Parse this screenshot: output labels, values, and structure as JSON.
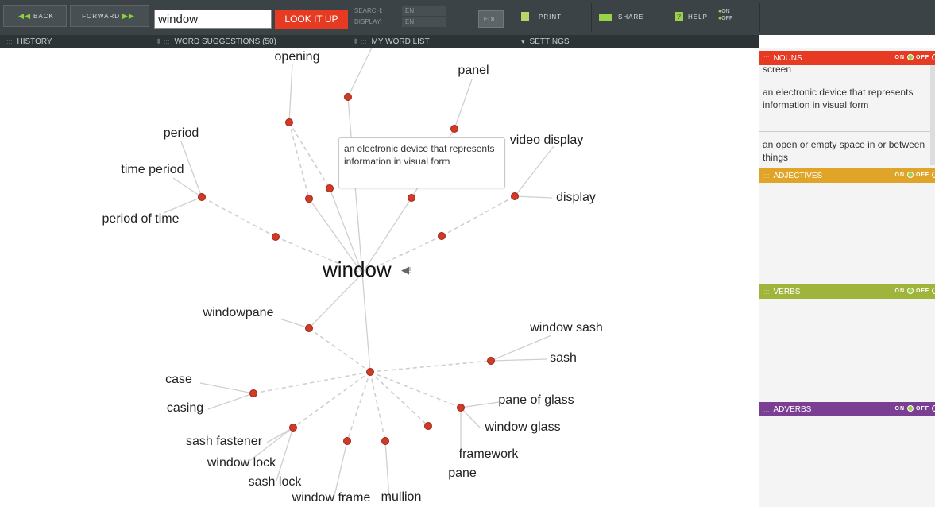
{
  "toolbar": {
    "back_label": "BACK",
    "forward_label": "FORWARD",
    "search_value": "window",
    "lookup_label": "LOOK IT UP",
    "search_lang_label": "SEARCH:",
    "search_lang_value": "EN",
    "display_lang_label": "DISPLAY:",
    "display_lang_value": "EN",
    "edit_label": "EDIT",
    "print_label": "PRINT",
    "share_label": "SHARE",
    "help_label": "HELP",
    "help_on": "ON",
    "help_off": "OFF"
  },
  "subbar": {
    "history": "HISTORY",
    "suggestions": "WORD SUGGESTIONS (50)",
    "wordlist": "MY WORD LIST",
    "settings": "SETTINGS"
  },
  "graph": {
    "center_word": "window",
    "tooltip": "an electronic device that represents information in visual form",
    "labels": {
      "opening": "opening",
      "panel": "panel",
      "period": "period",
      "video_display": "video display",
      "time_period": "time period",
      "display": "display",
      "period_of_time": "period of time",
      "windowpane": "windowpane",
      "window_sash": "window sash",
      "sash": "sash",
      "case": "case",
      "pane_of_glass": "pane of glass",
      "casing": "casing",
      "window_glass": "window glass",
      "sash_fastener": "sash fastener",
      "framework": "framework",
      "window_lock": "window lock",
      "pane": "pane",
      "sash_lock": "sash lock",
      "window_frame": "window frame",
      "mullion": "mullion"
    }
  },
  "panel": {
    "nouns": {
      "title": "NOUNS",
      "on": "ON",
      "off": "OFF",
      "color": "#e63a22",
      "cut_text": "screen",
      "def1": "an electronic device that represents information in visual form",
      "def2": "an open or empty space in or between things"
    },
    "adjectives": {
      "title": "ADJECTIVES",
      "on": "ON",
      "off": "OFF",
      "color": "#e0a528"
    },
    "verbs": {
      "title": "VERBS",
      "on": "ON",
      "off": "OFF",
      "color": "#9fb43a"
    },
    "adverbs": {
      "title": "ADVERBS",
      "on": "ON",
      "off": "OFF",
      "color": "#7a3f93"
    }
  }
}
